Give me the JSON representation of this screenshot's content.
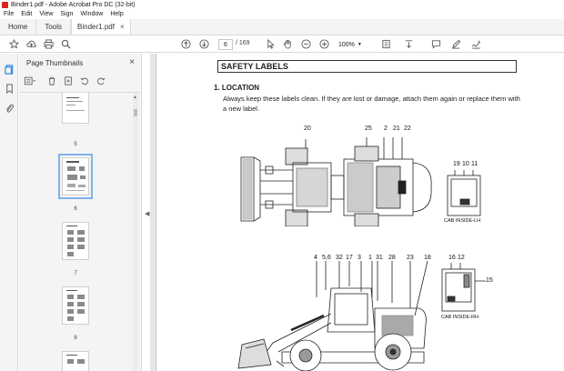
{
  "window": {
    "title": "Binder1.pdf - Adobe Acrobat Pro DC (32-bit)"
  },
  "menu": [
    "File",
    "Edit",
    "View",
    "Sign",
    "Window",
    "Help"
  ],
  "tabs": {
    "home": "Home",
    "tools": "Tools",
    "document": "Binder1.pdf",
    "close": "×"
  },
  "toolbar": {
    "current_page": "6",
    "total_pages": "/ 169",
    "zoom": "100%",
    "icons": [
      "bookmark-star-icon",
      "upload-icon",
      "print-icon",
      "search-icon",
      "page-up-icon",
      "page-down-icon",
      "hand-icon",
      "zoom-out-icon",
      "zoom-in-icon",
      "fit-page-icon",
      "scroll-mode-icon",
      "comment-icon",
      "pen-icon",
      "sign-icon"
    ]
  },
  "thumbnail_panel": {
    "title": "Page Thumbnails",
    "close": "×",
    "thumbnails": [
      {
        "label": "5"
      },
      {
        "label": "6",
        "selected": true
      },
      {
        "label": "7"
      },
      {
        "label": "8"
      }
    ]
  },
  "document": {
    "section_title": "SAFETY LABELS",
    "location_heading": "1. LOCATION",
    "paragraph": "Always keep these labels clean.  If they are lost or damage, attach them again or replace them with a new label.",
    "top_view_numbers": [
      "20",
      "25",
      "2",
      "21",
      "22"
    ],
    "cab_lh_numbers": [
      "19",
      "10",
      "11"
    ],
    "cab_lh_caption": "CAB INSIDE-LH",
    "side_view_numbers": [
      "4",
      "5,6",
      "32",
      "17",
      "3",
      "1",
      "31",
      "28",
      "23",
      "18"
    ],
    "cab_rh_numbers": [
      "16",
      "12",
      "15"
    ],
    "cab_rh_caption": "CAB INSIDE-RH"
  }
}
